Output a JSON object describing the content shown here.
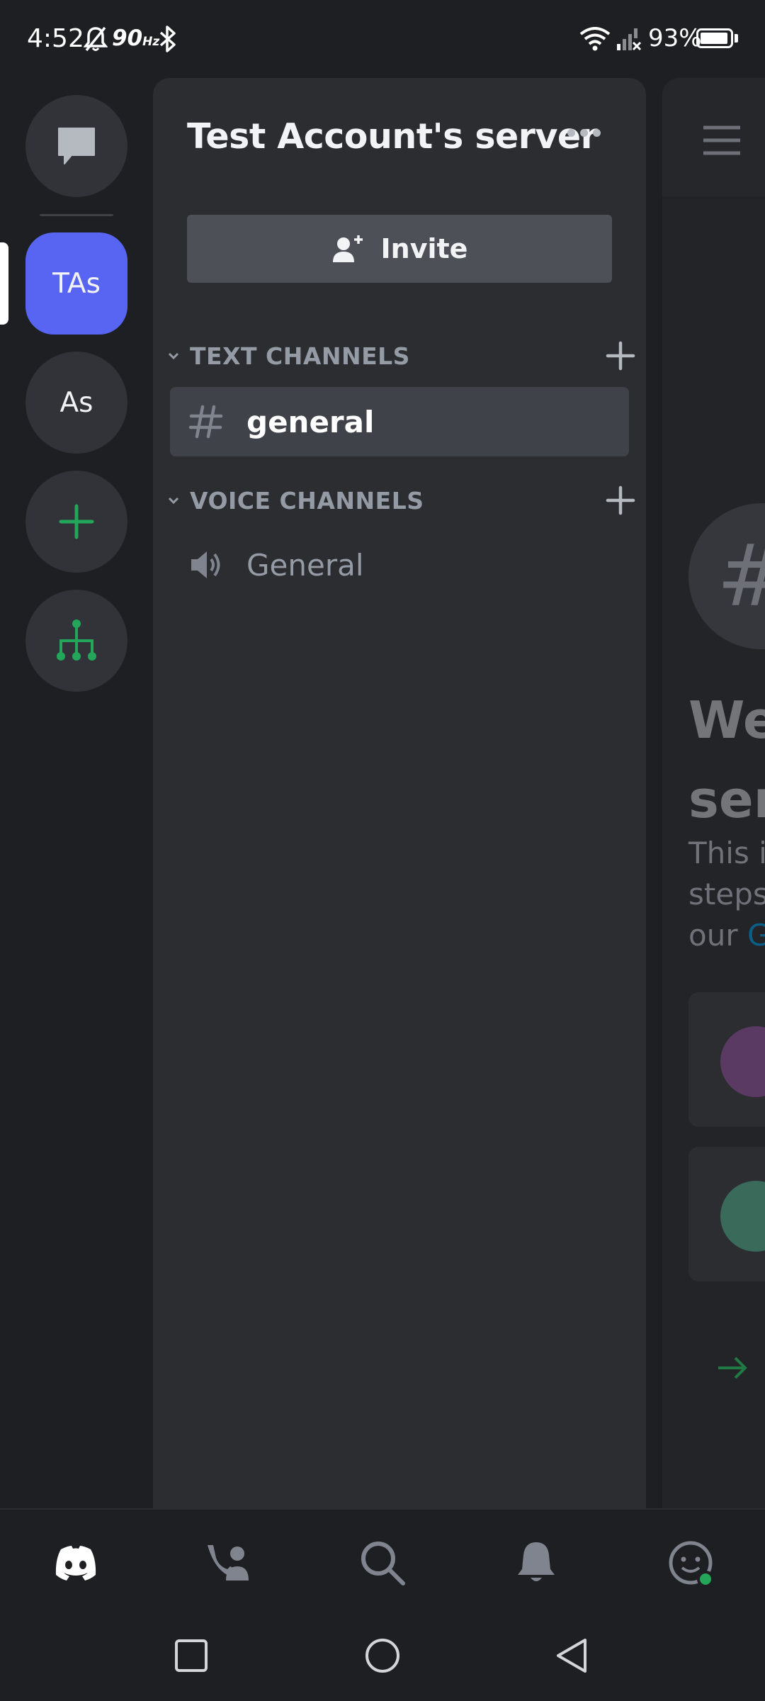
{
  "status_bar": {
    "time": "4:52",
    "refresh_rate": "90",
    "refresh_unit": "Hz",
    "battery": "93%",
    "icons": [
      "mute-bell-icon",
      "bluetooth-icon",
      "wifi-icon",
      "signal-icon",
      "battery-icon"
    ]
  },
  "server_rail": {
    "items": [
      {
        "name": "direct-messages",
        "icon": "chat-bubble-icon"
      },
      {
        "name": "server-tas",
        "label": "TAs",
        "selected": true
      },
      {
        "name": "server-as",
        "label": "As"
      },
      {
        "name": "add-server",
        "icon": "plus-icon"
      },
      {
        "name": "discover",
        "icon": "hub-tree-icon"
      }
    ]
  },
  "channel_panel": {
    "server_name": "Test Account's server",
    "invite_label": "Invite",
    "categories": [
      {
        "label": "TEXT CHANNELS",
        "channels": [
          {
            "name": "general",
            "type": "text",
            "selected": true
          }
        ]
      },
      {
        "label": "VOICE CHANNELS",
        "channels": [
          {
            "name": "General",
            "type": "voice",
            "selected": false
          }
        ]
      }
    ]
  },
  "main_peek": {
    "hash_glyph": "#",
    "welcome_line1": "We",
    "welcome_line2": "ser",
    "desc_line1": "This i",
    "desc_line2": "steps",
    "desc_line3_prefix": "our ",
    "desc_link": "G"
  },
  "bottom_nav": {
    "items": [
      "discord-home-icon",
      "friends-icon",
      "search-icon",
      "notifications-bell-icon",
      "profile-icon"
    ]
  },
  "colors": {
    "background": "#1e1f22",
    "panel": "#2b2d31",
    "selected": "#404249",
    "blurple": "#5865f2",
    "green": "#23a55a",
    "muted_text": "#949ba4"
  }
}
